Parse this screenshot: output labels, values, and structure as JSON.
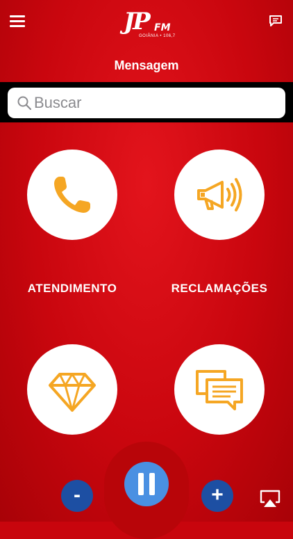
{
  "header": {
    "logo_letters": "JP",
    "logo_fm": "FM",
    "logo_sub": "GOIÂNIA • 106,7",
    "title": "Mensagem"
  },
  "search": {
    "placeholder": "Buscar"
  },
  "tiles": [
    {
      "label": "ATENDIMENTO",
      "icon": "phone-icon"
    },
    {
      "label": "RECLAMAÇÕES",
      "icon": "megaphone-icon"
    },
    {
      "label": "",
      "icon": "diamond-icon"
    },
    {
      "label": "",
      "icon": "chat-bubbles-icon"
    }
  ],
  "player": {
    "minus_label": "-",
    "plus_label": "+",
    "state": "playing"
  },
  "colors": {
    "background": "#c8050d",
    "icon_orange": "#f5a623",
    "play_blue": "#4a90e2",
    "volume_blue": "#1d4fa3"
  }
}
